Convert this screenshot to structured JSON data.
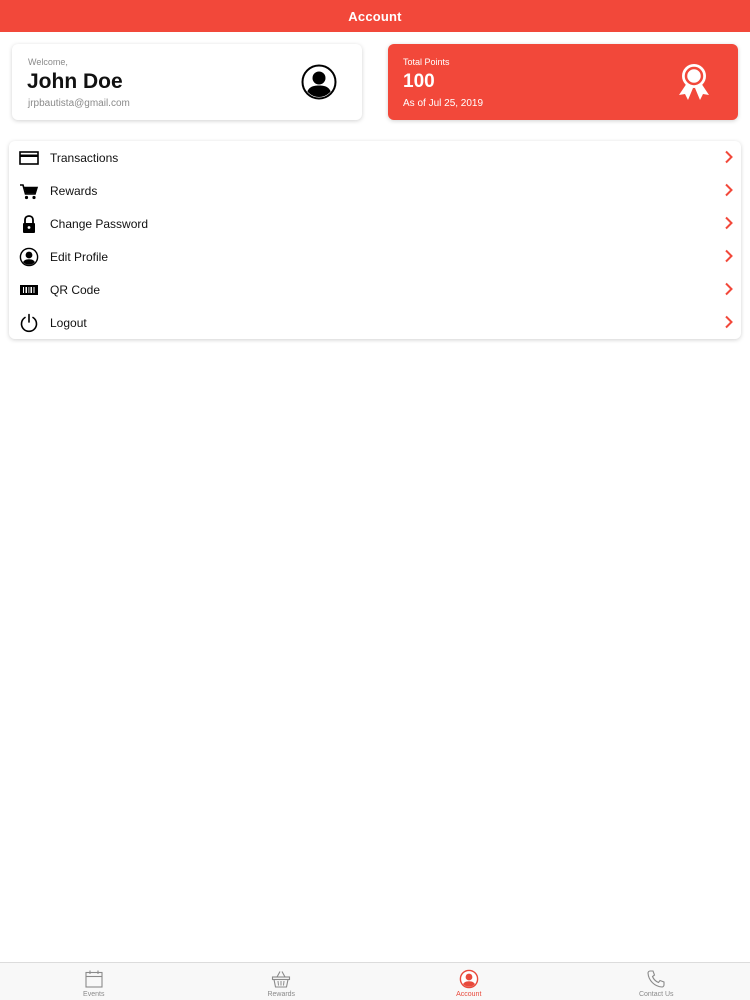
{
  "nav": {
    "title": "Account"
  },
  "profile": {
    "welcome_label": "Welcome,",
    "name": "John Doe",
    "email": "jrpbautista@gmail.com"
  },
  "points": {
    "label": "Total Points",
    "value": "100",
    "as_of": "As of Jul 25, 2019"
  },
  "menu": {
    "items": [
      {
        "label": "Transactions",
        "icon": "credit-card-icon"
      },
      {
        "label": "Rewards",
        "icon": "cart-icon"
      },
      {
        "label": "Change Password",
        "icon": "lock-icon"
      },
      {
        "label": "Edit Profile",
        "icon": "user-circle-icon"
      },
      {
        "label": "QR Code",
        "icon": "barcode-icon"
      },
      {
        "label": "Logout",
        "icon": "power-icon"
      }
    ]
  },
  "tabs": [
    {
      "label": "Events",
      "icon": "calendar-icon",
      "active": false
    },
    {
      "label": "Rewards",
      "icon": "basket-icon",
      "active": false
    },
    {
      "label": "Account",
      "icon": "user-circle-icon",
      "active": true
    },
    {
      "label": "Contact Us",
      "icon": "phone-icon",
      "active": false
    }
  ],
  "colors": {
    "accent": "#f2483a",
    "tab_active": "#e8493b",
    "tab_inactive": "#8a8a8a"
  }
}
